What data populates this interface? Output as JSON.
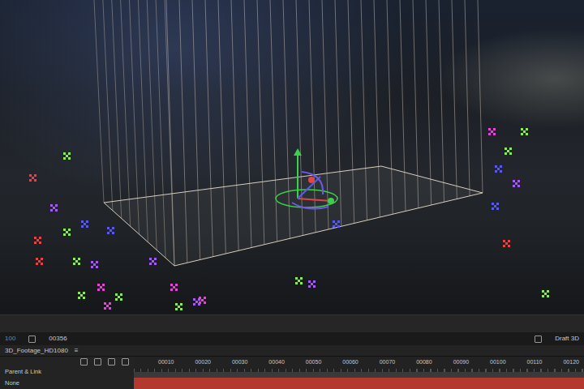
{
  "status_bar": {
    "zoom": "100",
    "timecode": "00356",
    "render_mode": "Draft 3D"
  },
  "tab": {
    "label": "3D_Footage_HD1080",
    "menu": "≡"
  },
  "timeline": {
    "column": "Parent & Link",
    "value": "None",
    "ruler": [
      "00010",
      "00020",
      "00030",
      "00040",
      "00050",
      "00060",
      "00070",
      "00080",
      "00090",
      "00100",
      "00110",
      "00120"
    ]
  },
  "track_points": [
    {
      "color": "#e04646"
    },
    {
      "color": "#a25cf0"
    },
    {
      "color": "#8fe85a"
    },
    {
      "color": "#5a5ae8"
    },
    {
      "color": "#e04ad2"
    },
    {
      "color": "#8fe85a"
    },
    {
      "color": "#e04646"
    },
    {
      "color": "#a25cf0"
    },
    {
      "color": "#8fe85a"
    },
    {
      "color": "#e04ad2"
    },
    {
      "color": "#5a5ae8"
    },
    {
      "color": "#8fe85a"
    },
    {
      "color": "#a25cf0"
    },
    {
      "color": "#e04646"
    },
    {
      "color": "#8fe85a"
    },
    {
      "color": "#e04ad2"
    },
    {
      "color": "#a25cf0"
    },
    {
      "color": "#8fe85a"
    },
    {
      "color": "#5a5ae8"
    },
    {
      "color": "#e04ad2"
    },
    {
      "color": "#8fe85a"
    },
    {
      "color": "#a25cf0"
    },
    {
      "color": "#e04646"
    },
    {
      "color": "#8fe85a"
    },
    {
      "color": "#5a5ae8"
    },
    {
      "color": "#a25cf0"
    },
    {
      "color": "#e04ad2"
    },
    {
      "color": "#8fe85a"
    },
    {
      "color": "#5a5ae8"
    },
    {
      "color": "#8fe85a"
    }
  ]
}
